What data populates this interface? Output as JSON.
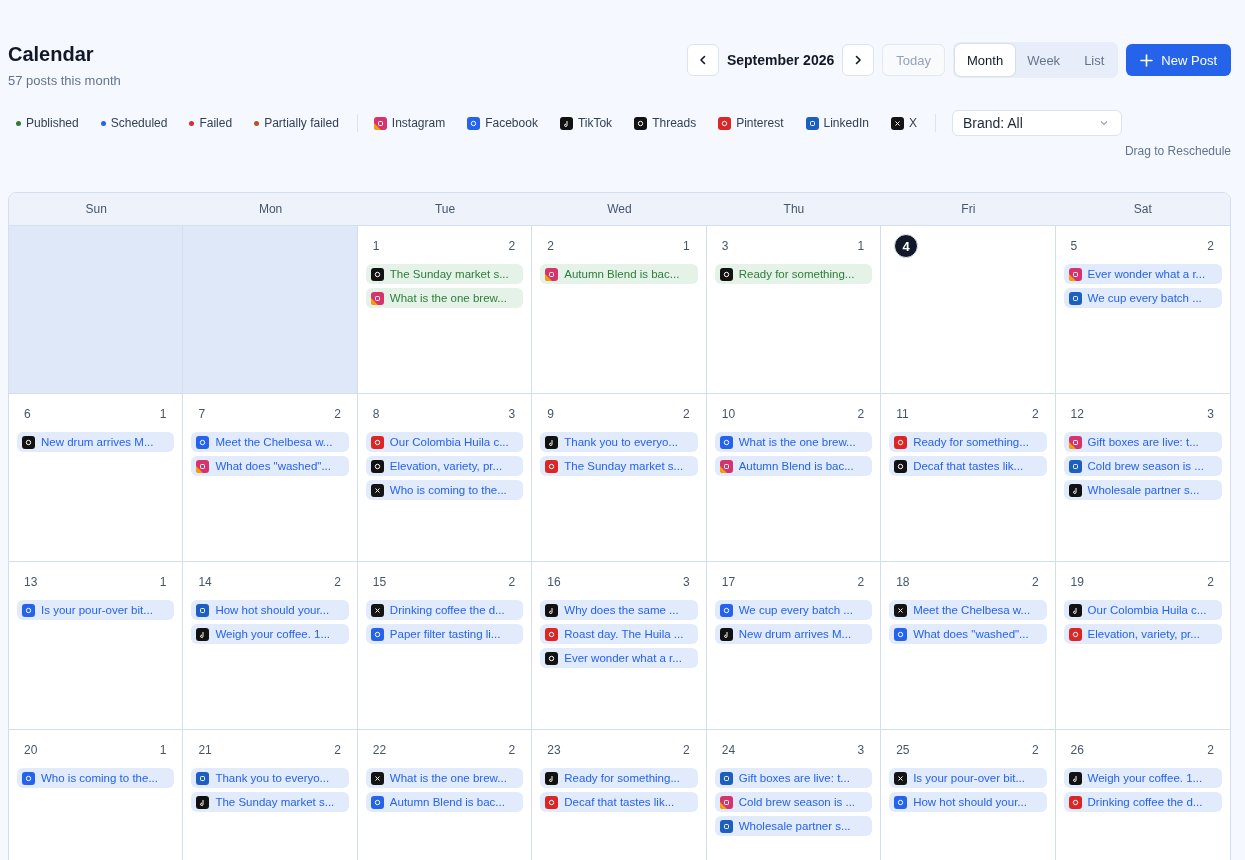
{
  "header": {
    "title": "Calendar",
    "subtitle": "57 posts this month"
  },
  "nav": {
    "month": "September 2026",
    "today": "Today",
    "views": [
      {
        "label": "Month",
        "selected": true
      },
      {
        "label": "Week",
        "selected": false
      },
      {
        "label": "List",
        "selected": false
      }
    ],
    "new_post": "New Post"
  },
  "statuses": [
    {
      "label": "Published",
      "color": "#2e7d32"
    },
    {
      "label": "Scheduled",
      "color": "#2563eb"
    },
    {
      "label": "Failed",
      "color": "#d32f2f"
    },
    {
      "label": "Partially failed",
      "color": "#b5541c"
    }
  ],
  "platforms": [
    {
      "kind": "instagram",
      "label": "Instagram",
      "color": "#d6336c"
    },
    {
      "kind": "facebook",
      "label": "Facebook",
      "color": "#2563eb"
    },
    {
      "kind": "tiktok",
      "label": "TikTok",
      "color": "#111111"
    },
    {
      "kind": "threads",
      "label": "Threads",
      "color": "#121212"
    },
    {
      "kind": "pinterest",
      "label": "Pinterest",
      "color": "#dc2626"
    },
    {
      "kind": "linkedin",
      "label": "LinkedIn",
      "color": "#1d5fc0"
    },
    {
      "kind": "x",
      "label": "X",
      "color": "#141414"
    }
  ],
  "brand_filter": {
    "value": "Brand: All"
  },
  "hint": "Drag to Reschedule",
  "weekdays": [
    "Sun",
    "Mon",
    "Tue",
    "Wed",
    "Thu",
    "Fri",
    "Sat"
  ],
  "weeks": [
    [
      {
        "outside": true
      },
      {
        "outside": true
      },
      {
        "day": "1",
        "count": "2",
        "outside": false,
        "today": false,
        "posts": [
          {
            "kind": "threads",
            "published": true,
            "text": "The Sunday market s..."
          },
          {
            "kind": "instagram",
            "published": true,
            "text": "What is the one brew..."
          }
        ]
      },
      {
        "day": "2",
        "count": "1",
        "outside": false,
        "today": false,
        "posts": [
          {
            "kind": "instagram",
            "published": true,
            "text": "Autumn Blend is bac..."
          }
        ]
      },
      {
        "day": "3",
        "count": "1",
        "outside": false,
        "today": false,
        "posts": [
          {
            "kind": "threads",
            "published": true,
            "text": "Ready for something..."
          }
        ]
      },
      {
        "day": "4",
        "outside": false,
        "today": true
      },
      {
        "day": "5",
        "count": "2",
        "outside": false,
        "today": false,
        "posts": [
          {
            "kind": "instagram",
            "published": false,
            "text": "Ever wonder what a r..."
          },
          {
            "kind": "linkedin",
            "published": false,
            "text": "We cup every batch ..."
          }
        ]
      }
    ],
    [
      {
        "day": "6",
        "count": "1",
        "outside": false,
        "today": false,
        "posts": [
          {
            "kind": "threads",
            "published": false,
            "text": "New drum arrives M..."
          }
        ]
      },
      {
        "day": "7",
        "count": "2",
        "outside": false,
        "today": false,
        "posts": [
          {
            "kind": "facebook",
            "published": false,
            "text": "Meet the Chelbesa w..."
          },
          {
            "kind": "instagram",
            "published": false,
            "text": "What does \"washed\"..."
          }
        ]
      },
      {
        "day": "8",
        "count": "3",
        "outside": false,
        "today": false,
        "posts": [
          {
            "kind": "pinterest",
            "published": false,
            "text": "Our Colombia Huila c..."
          },
          {
            "kind": "threads",
            "published": false,
            "text": "Elevation, variety, pr..."
          },
          {
            "kind": "x",
            "published": false,
            "text": "Who is coming to the..."
          }
        ]
      },
      {
        "day": "9",
        "count": "2",
        "outside": false,
        "today": false,
        "posts": [
          {
            "kind": "tiktok",
            "published": false,
            "text": "Thank you to everyo..."
          },
          {
            "kind": "pinterest",
            "published": false,
            "text": "The Sunday market s..."
          }
        ]
      },
      {
        "day": "10",
        "count": "2",
        "outside": false,
        "today": false,
        "posts": [
          {
            "kind": "facebook",
            "published": false,
            "text": "What is the one brew..."
          },
          {
            "kind": "instagram",
            "published": false,
            "text": "Autumn Blend is bac..."
          }
        ]
      },
      {
        "day": "11",
        "count": "2",
        "outside": false,
        "today": false,
        "posts": [
          {
            "kind": "pinterest",
            "published": false,
            "text": "Ready for something..."
          },
          {
            "kind": "threads",
            "published": false,
            "text": "Decaf that tastes lik..."
          }
        ]
      },
      {
        "day": "12",
        "count": "3",
        "outside": false,
        "today": false,
        "posts": [
          {
            "kind": "instagram",
            "published": false,
            "text": "Gift boxes are live: t..."
          },
          {
            "kind": "linkedin",
            "published": false,
            "text": "Cold brew season is ..."
          },
          {
            "kind": "tiktok",
            "published": false,
            "text": "Wholesale partner s..."
          }
        ]
      }
    ],
    [
      {
        "day": "13",
        "count": "1",
        "outside": false,
        "today": false,
        "posts": [
          {
            "kind": "facebook",
            "published": false,
            "text": "Is your pour-over bit..."
          }
        ]
      },
      {
        "day": "14",
        "count": "2",
        "outside": false,
        "today": false,
        "posts": [
          {
            "kind": "linkedin",
            "published": false,
            "text": "How hot should your..."
          },
          {
            "kind": "tiktok",
            "published": false,
            "text": "Weigh your coffee. 1..."
          }
        ]
      },
      {
        "day": "15",
        "count": "2",
        "outside": false,
        "today": false,
        "posts": [
          {
            "kind": "x",
            "published": false,
            "text": "Drinking coffee the d..."
          },
          {
            "kind": "facebook",
            "published": false,
            "text": "Paper filter tasting li..."
          }
        ]
      },
      {
        "day": "16",
        "count": "3",
        "outside": false,
        "today": false,
        "posts": [
          {
            "kind": "tiktok",
            "published": false,
            "text": "Why does the same ..."
          },
          {
            "kind": "pinterest",
            "published": false,
            "text": "Roast day. The Huila ..."
          },
          {
            "kind": "threads",
            "published": false,
            "text": "Ever wonder what a r..."
          }
        ]
      },
      {
        "day": "17",
        "count": "2",
        "outside": false,
        "today": false,
        "posts": [
          {
            "kind": "facebook",
            "published": false,
            "text": "We cup every batch ..."
          },
          {
            "kind": "tiktok",
            "published": false,
            "text": "New drum arrives M..."
          }
        ]
      },
      {
        "day": "18",
        "count": "2",
        "outside": false,
        "today": false,
        "posts": [
          {
            "kind": "x",
            "published": false,
            "text": "Meet the Chelbesa w..."
          },
          {
            "kind": "facebook",
            "published": false,
            "text": "What does \"washed\"..."
          }
        ]
      },
      {
        "day": "19",
        "count": "2",
        "outside": false,
        "today": false,
        "posts": [
          {
            "kind": "tiktok",
            "published": false,
            "text": "Our Colombia Huila c..."
          },
          {
            "kind": "pinterest",
            "published": false,
            "text": "Elevation, variety, pr..."
          }
        ]
      }
    ],
    [
      {
        "day": "20",
        "count": "1",
        "outside": false,
        "today": false,
        "posts": [
          {
            "kind": "facebook",
            "published": false,
            "text": "Who is coming to the..."
          }
        ]
      },
      {
        "day": "21",
        "count": "2",
        "outside": false,
        "today": false,
        "posts": [
          {
            "kind": "linkedin",
            "published": false,
            "text": "Thank you to everyo..."
          },
          {
            "kind": "tiktok",
            "published": false,
            "text": "The Sunday market s..."
          }
        ]
      },
      {
        "day": "22",
        "count": "2",
        "outside": false,
        "today": false,
        "posts": [
          {
            "kind": "x",
            "published": false,
            "text": "What is the one brew..."
          },
          {
            "kind": "facebook",
            "published": false,
            "text": "Autumn Blend is bac..."
          }
        ]
      },
      {
        "day": "23",
        "count": "2",
        "outside": false,
        "today": false,
        "posts": [
          {
            "kind": "tiktok",
            "published": false,
            "text": "Ready for something..."
          },
          {
            "kind": "pinterest",
            "published": false,
            "text": "Decaf that tastes lik..."
          }
        ]
      },
      {
        "day": "24",
        "count": "3",
        "outside": false,
        "today": false,
        "posts": [
          {
            "kind": "linkedin",
            "published": false,
            "text": "Gift boxes are live: t..."
          },
          {
            "kind": "instagram",
            "published": false,
            "text": "Cold brew season is ..."
          },
          {
            "kind": "linkedin",
            "published": false,
            "text": "Wholesale partner s..."
          }
        ]
      },
      {
        "day": "25",
        "count": "2",
        "outside": false,
        "today": false,
        "posts": [
          {
            "kind": "x",
            "published": false,
            "text": "Is your pour-over bit..."
          },
          {
            "kind": "facebook",
            "published": false,
            "text": "How hot should your..."
          }
        ]
      },
      {
        "day": "26",
        "count": "2",
        "outside": false,
        "today": false,
        "posts": [
          {
            "kind": "tiktok",
            "published": false,
            "text": "Weigh your coffee. 1..."
          },
          {
            "kind": "pinterest",
            "published": false,
            "text": "Drinking coffee the d..."
          }
        ]
      }
    ]
  ]
}
